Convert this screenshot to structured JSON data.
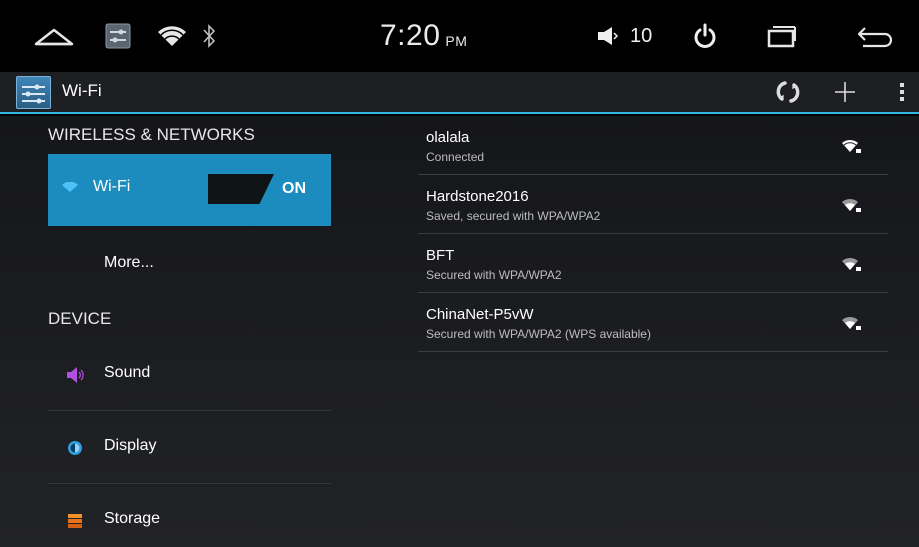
{
  "status_bar": {
    "time": "7:20",
    "ampm": "PM",
    "volume": "10",
    "icons": [
      "home-icon",
      "settings-icon",
      "wifi-icon",
      "bluetooth-icon",
      "volume-icon",
      "power-icon",
      "recents-icon",
      "back-icon"
    ]
  },
  "action_bar": {
    "title": "Wi-Fi",
    "icons": [
      "settings-app-icon",
      "wps-icon",
      "add-icon",
      "overflow-icon"
    ],
    "accent_color": "#33b5e5"
  },
  "sidebar": {
    "wireless_header": "WIRELESS & NETWORKS",
    "wifi": {
      "label": "Wi-Fi",
      "toggle": "ON",
      "selected_color": "#1c8cbf"
    },
    "more": {
      "label": "More..."
    },
    "device_header": "DEVICE",
    "device_items": [
      {
        "label": "Sound",
        "icon": "sound-icon"
      },
      {
        "label": "Display",
        "icon": "display-icon"
      },
      {
        "label": "Storage",
        "icon": "storage-icon"
      }
    ]
  },
  "networks": [
    {
      "ssid": "olalala",
      "status": "Connected",
      "signal_icon": "wifi-signal-strong-icon"
    },
    {
      "ssid": "Hardstone2016",
      "status": "Saved, secured with WPA/WPA2",
      "signal_icon": "wifi-signal-locked-icon"
    },
    {
      "ssid": "BFT",
      "status": "Secured with WPA/WPA2",
      "signal_icon": "wifi-signal-locked-icon"
    },
    {
      "ssid": "ChinaNet-P5vW",
      "status": "Secured with WPA/WPA2 (WPS available)",
      "signal_icon": "wifi-signal-locked-icon"
    }
  ]
}
